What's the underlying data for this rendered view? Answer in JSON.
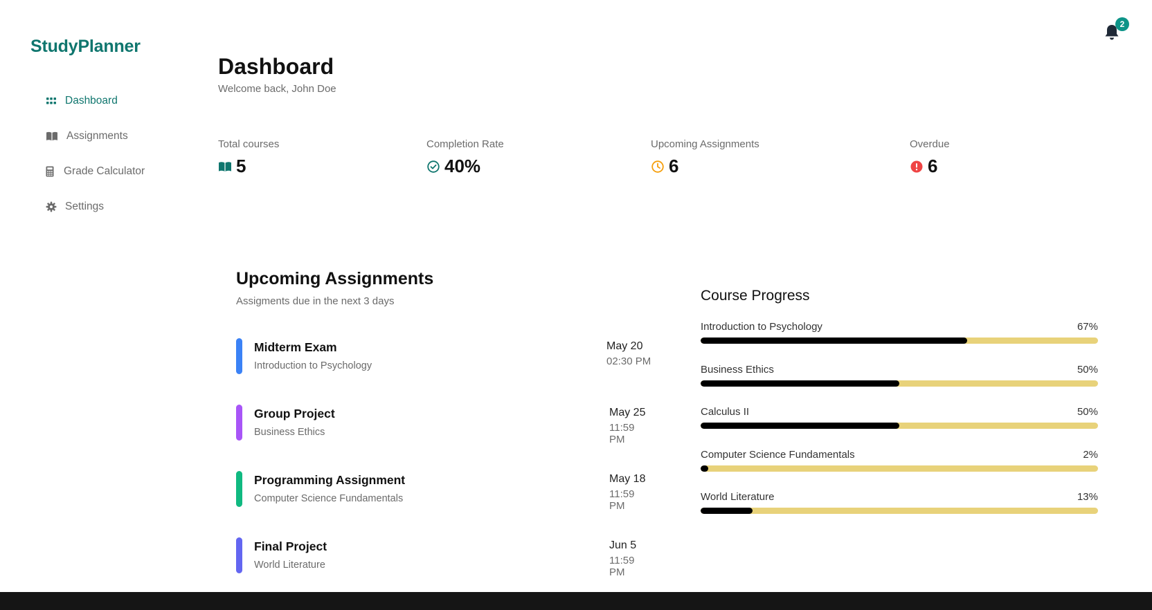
{
  "app": {
    "name": "StudyPlanner"
  },
  "sidebar": {
    "items": [
      {
        "label": "Dashboard",
        "icon": "grid-icon",
        "active": true
      },
      {
        "label": "Assignments",
        "icon": "book-icon",
        "active": false
      },
      {
        "label": "Grade Calculator",
        "icon": "calculator-icon",
        "active": false
      },
      {
        "label": "Settings",
        "icon": "gear-icon",
        "active": false
      }
    ]
  },
  "header": {
    "title": "Dashboard",
    "subtitle": "Welcome back, John Doe",
    "notification_count": "2"
  },
  "stats": [
    {
      "label": "Total courses",
      "value": "5",
      "icon": "book-open-icon",
      "color": "#0f766e"
    },
    {
      "label": "Completion Rate",
      "value": "40%",
      "icon": "check-circle-icon",
      "color": "#0f766e"
    },
    {
      "label": "Upcoming Assignments",
      "value": "6",
      "icon": "clock-icon",
      "color": "#f59e0b"
    },
    {
      "label": "Overdue",
      "value": "6",
      "icon": "alert-circle-icon",
      "color": "#ef4444"
    }
  ],
  "upcoming": {
    "title": "Upcoming Assignments",
    "subtitle": "Assigments due in the next 3 days",
    "items": [
      {
        "title": "Midterm Exam",
        "course": "Introduction to Psychology",
        "date": "May 20",
        "time": "02:30 PM",
        "color": "#3b82f6"
      },
      {
        "title": "Group Project",
        "course": "Business Ethics",
        "date": "May 25",
        "time": "11:59 PM",
        "color": "#a855f7"
      },
      {
        "title": "Programming Assignment",
        "course": "Computer Science Fundamentals",
        "date": "May 18",
        "time": "11:59 PM",
        "color": "#10b981"
      },
      {
        "title": "Final Project",
        "course": "World Literature",
        "date": "Jun 5",
        "time": "11:59 PM",
        "color": "#6366f1"
      }
    ]
  },
  "course_progress": {
    "title": "Course Progress",
    "track_color": "#e8d27a",
    "fill_color": "#000000",
    "courses": [
      {
        "name": "Introduction to Psychology",
        "percent_label": "67%",
        "progress": 0.67
      },
      {
        "name": "Business Ethics",
        "percent_label": "50%",
        "progress": 0.5
      },
      {
        "name": "Calculus II",
        "percent_label": "50%",
        "progress": 0.5
      },
      {
        "name": "Computer Science Fundamentals",
        "percent_label": "2%",
        "progress": 0.02
      },
      {
        "name": "World Literature",
        "percent_label": "13%",
        "progress": 0.13
      }
    ]
  }
}
